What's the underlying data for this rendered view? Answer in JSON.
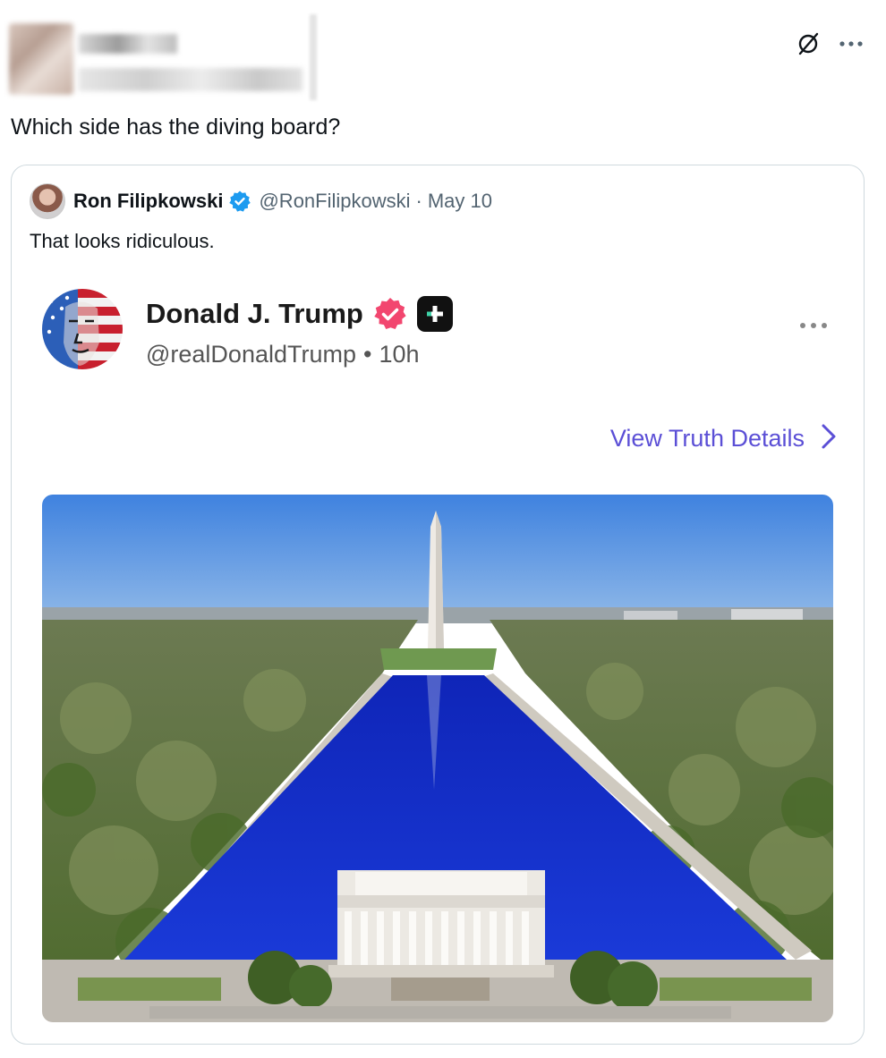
{
  "tweet": {
    "text": "Which side has the diving board?"
  },
  "top_actions": {
    "icons": [
      "grok-slash-icon",
      "more-icon"
    ]
  },
  "quoted": {
    "author_name": "Ron Filipkowski",
    "handle": "@RonFilipkowski",
    "separator": "·",
    "date": "May 10",
    "text": "That looks ridiculous."
  },
  "truth": {
    "name": "Donald J. Trump",
    "handle": "@realDonaldTrump",
    "dot": "•",
    "time": "10h",
    "view_details_label": "View Truth Details"
  },
  "colors": {
    "verified_blue": "#1d9bf0",
    "truth_badge": "#f2466f",
    "view_details": "#5b4fd6",
    "pool": "#1430c8",
    "sky": "#4f8fe3"
  }
}
